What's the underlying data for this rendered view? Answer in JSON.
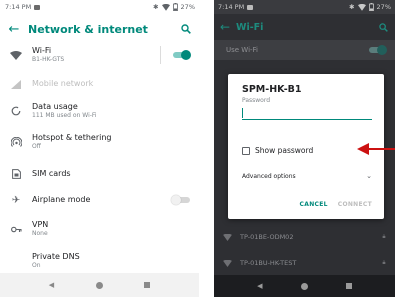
{
  "left_screen": {
    "status_bar": {
      "time": "7:14 PM",
      "battery": "27%"
    },
    "app_bar": {
      "title": "Network & internet"
    },
    "rows": [
      {
        "id": "wifi",
        "title": "Wi-Fi",
        "subtitle": "B1-HK-GTS",
        "toggle": "on",
        "icon": "wifi-icon"
      },
      {
        "id": "mobile",
        "title": "Mobile network",
        "subtitle": "",
        "disabled": true,
        "icon": "signal-icon"
      },
      {
        "id": "data",
        "title": "Data usage",
        "subtitle": "111 MB used on Wi-Fi",
        "icon": "data-usage-icon"
      },
      {
        "id": "hotspot",
        "title": "Hotspot & tethering",
        "subtitle": "Off",
        "icon": "hotspot-icon"
      },
      {
        "id": "sim",
        "title": "SIM cards",
        "subtitle": "",
        "icon": "sim-card-icon"
      },
      {
        "id": "airplane",
        "title": "Airplane mode",
        "subtitle": "",
        "toggle": "off",
        "icon": "airplane-icon"
      },
      {
        "id": "vpn",
        "title": "VPN",
        "subtitle": "None",
        "icon": "vpn-key-icon"
      },
      {
        "id": "dns",
        "title": "Private DNS",
        "subtitle": "On",
        "icon": ""
      }
    ]
  },
  "right_screen": {
    "status_bar": {
      "time": "7:14 PM",
      "battery": "27%"
    },
    "app_bar": {
      "title": "Wi-Fi"
    },
    "use_wifi": {
      "label": "Use Wi-Fi",
      "toggle": "on"
    },
    "networks": [
      {
        "name": "TP-01BE-ODM02",
        "locked": true
      },
      {
        "name": "TP-01BU-HK-TEST",
        "locked": true
      }
    ],
    "dialog": {
      "title": "SPM-HK-B1",
      "password_label": "Password",
      "password_value": "",
      "show_password_label": "Show password",
      "show_password_checked": false,
      "advanced_label": "Advanced options",
      "cancel_label": "CANCEL",
      "connect_label": "CONNECT"
    }
  },
  "colors": {
    "accent": "#00897b",
    "annotation_arrow": "#cc1111"
  }
}
